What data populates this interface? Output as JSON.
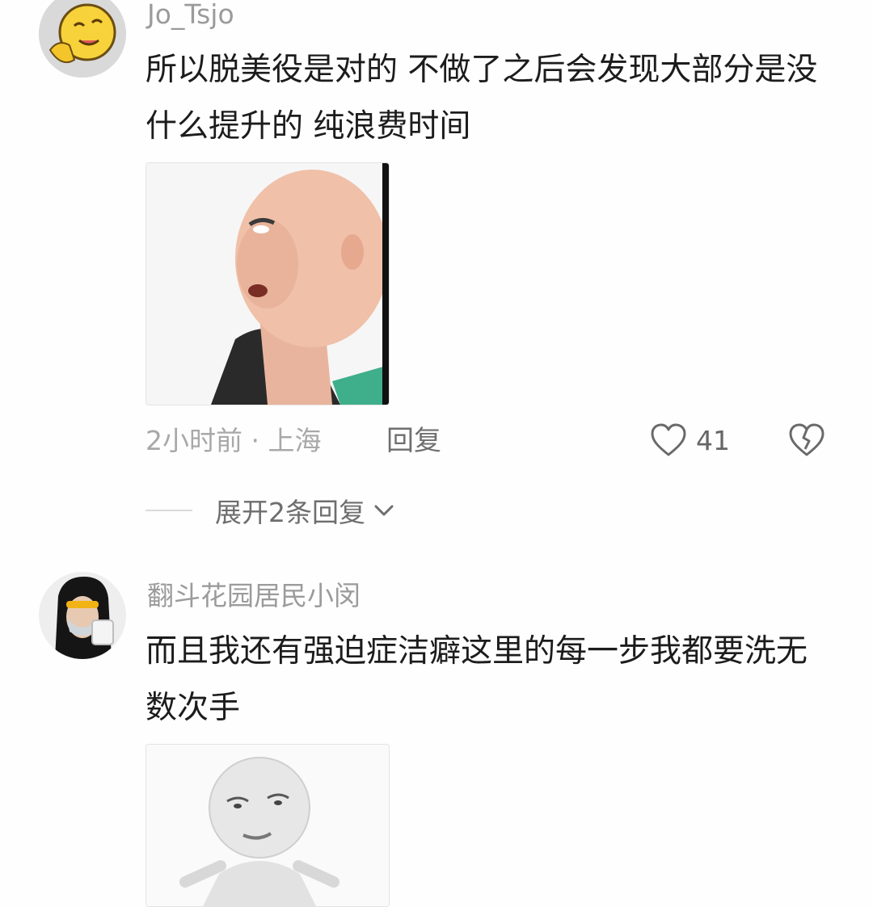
{
  "comments": [
    {
      "username": "Jo_Tsjo",
      "text": "所以脱美役是对的 不做了之后会发现大部分是没什么提升的 纯浪费时间",
      "meta": "2小时前 · 上海",
      "reply_label": "回复",
      "like_count": "41",
      "expand_label": "展开2条回复",
      "avatar_icon": "face-emoji-icon",
      "image_icon": "meme-bald-face-icon"
    },
    {
      "username": "翻斗花园居民小闵",
      "text": "而且我还有强迫症洁癖这里的每一步我都要洗无数次手",
      "avatar_icon": "user-photo-icon",
      "image_icon": "meme-white-figure-icon"
    }
  ],
  "colors": {
    "username": "#9b9b9b",
    "text": "#1c1c1c",
    "meta": "#a8a8a8",
    "background": "#fefefe"
  }
}
